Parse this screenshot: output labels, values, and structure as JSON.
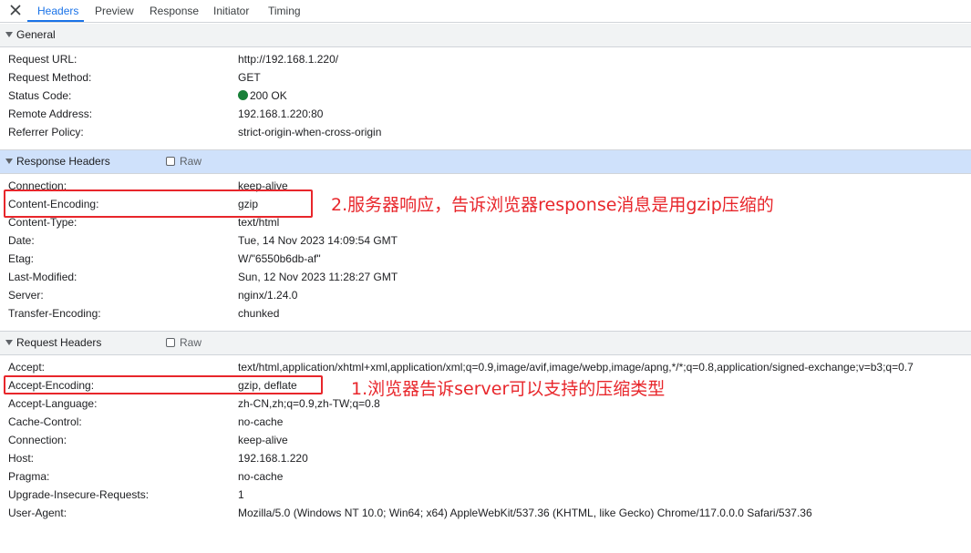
{
  "tabs": [
    "Headers",
    "Preview",
    "Response",
    "Initiator",
    "Timing"
  ],
  "general": {
    "title": "General",
    "rows": [
      {
        "key": "Request URL:",
        "value": "http://192.168.1.220/"
      },
      {
        "key": "Request Method:",
        "value": "GET"
      },
      {
        "key": "Status Code:",
        "value": "200 OK"
      },
      {
        "key": "Remote Address:",
        "value": "192.168.1.220:80"
      },
      {
        "key": "Referrer Policy:",
        "value": "strict-origin-when-cross-origin"
      }
    ]
  },
  "response": {
    "title": "Response Headers",
    "raw": "Raw",
    "rows": [
      {
        "key": "Connection:",
        "value": "keep-alive"
      },
      {
        "key": "Content-Encoding:",
        "value": "gzip"
      },
      {
        "key": "Content-Type:",
        "value": "text/html"
      },
      {
        "key": "Date:",
        "value": "Tue, 14 Nov 2023 14:09:54 GMT"
      },
      {
        "key": "Etag:",
        "value": "W/\"6550b6db-af\""
      },
      {
        "key": "Last-Modified:",
        "value": "Sun, 12 Nov 2023 11:28:27 GMT"
      },
      {
        "key": "Server:",
        "value": "nginx/1.24.0"
      },
      {
        "key": "Transfer-Encoding:",
        "value": "chunked"
      }
    ]
  },
  "request": {
    "title": "Request Headers",
    "raw": "Raw",
    "rows": [
      {
        "key": "Accept:",
        "value": "text/html,application/xhtml+xml,application/xml;q=0.9,image/avif,image/webp,image/apng,*/*;q=0.8,application/signed-exchange;v=b3;q=0.7"
      },
      {
        "key": "Accept-Encoding:",
        "value": "gzip, deflate"
      },
      {
        "key": "Accept-Language:",
        "value": "zh-CN,zh;q=0.9,zh-TW;q=0.8"
      },
      {
        "key": "Cache-Control:",
        "value": "no-cache"
      },
      {
        "key": "Connection:",
        "value": "keep-alive"
      },
      {
        "key": "Host:",
        "value": "192.168.1.220"
      },
      {
        "key": "Pragma:",
        "value": "no-cache"
      },
      {
        "key": "Upgrade-Insecure-Requests:",
        "value": "1"
      },
      {
        "key": "User-Agent:",
        "value": "Mozilla/5.0 (Windows NT 10.0; Win64; x64) AppleWebKit/537.36 (KHTML, like Gecko) Chrome/117.0.0.0 Safari/537.36"
      }
    ]
  },
  "annotations": {
    "response_note": "2.服务器响应，告诉浏览器response消息是用gzip压缩的",
    "request_note": "1.浏览器告诉server可以支持的压缩类型"
  },
  "colors": {
    "accent": "#1a73e8",
    "status_ok": "#188038",
    "annotation": "#e8262b",
    "selected_header": "#cfe1fb"
  }
}
